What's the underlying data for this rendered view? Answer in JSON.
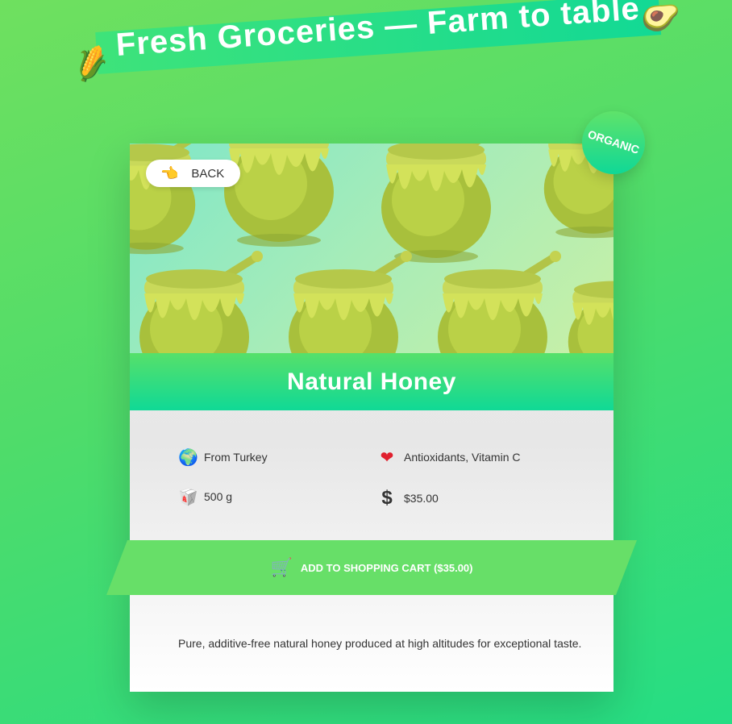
{
  "header": {
    "title": "Fresh Groceries — Farm to table",
    "left_icon": "corn-icon",
    "right_icon": "avocado-icon"
  },
  "badge": {
    "label": "ORGANIC"
  },
  "product": {
    "back_label": "BACK",
    "name": "Natural Honey",
    "image": "honey-pot-pattern",
    "origin": "From Turkey",
    "nutrients": "Antioxidants, Vitamin C",
    "weight": "500 g",
    "price": "$35.00",
    "description": "Pure, additive-free natural honey produced at high altitudes for exceptional taste."
  },
  "cart": {
    "label": "ADD TO SHOPPING CART ($35.00)"
  },
  "colors": {
    "accent": "#67df68",
    "accent_teal": "#10d996",
    "card_bg": "#ebebeb"
  }
}
